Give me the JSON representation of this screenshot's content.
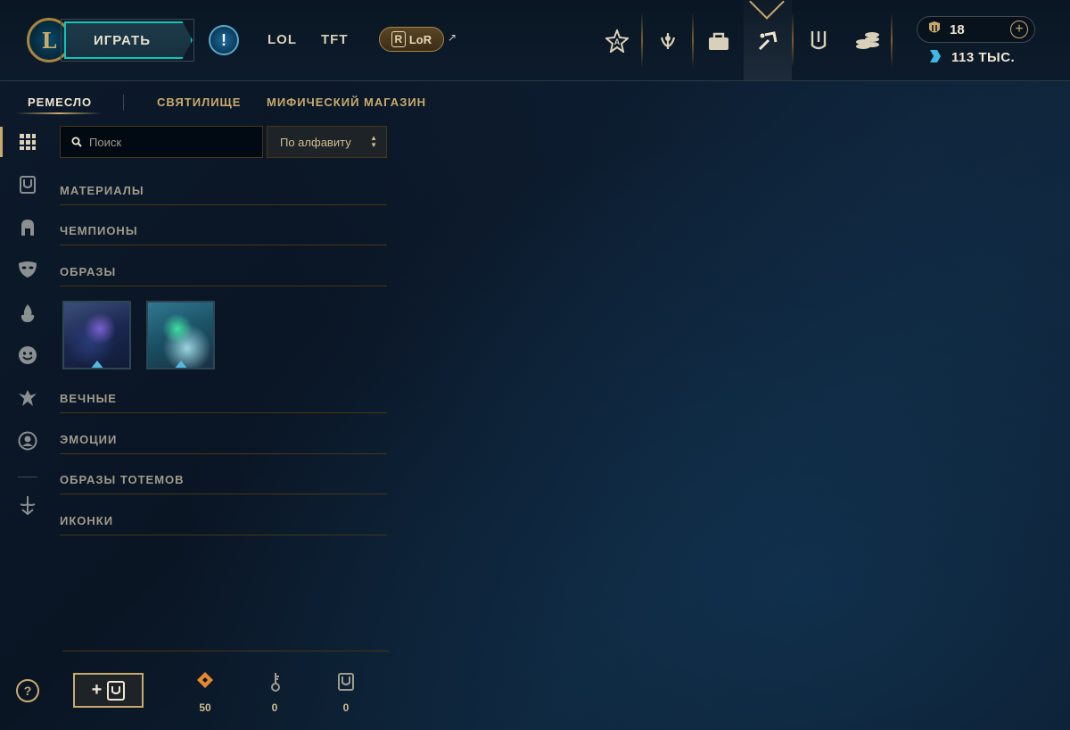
{
  "header": {
    "logo": "L",
    "play_label": "ИГРАТЬ",
    "alert_symbol": "!",
    "tabs": [
      "LOL",
      "TFT"
    ],
    "lor_label": "LoR",
    "lor_mark": "R",
    "lor_external": "↗",
    "nav_icons": [
      "home-crest-icon",
      "profile-laurel-icon",
      "collection-bag-icon",
      "loot-hammer-icon",
      "clash-banner-icon",
      "store-coins-icon"
    ],
    "active_nav": "loot-hammer-icon"
  },
  "currency": {
    "rp_value": "18",
    "be_value": "113 ТЫС.",
    "add_symbol": "+"
  },
  "subtabs": [
    "РЕМЕСЛО",
    "СВЯТИЛИЩЕ",
    "МИФИЧЕСКИЙ МАГАЗИН"
  ],
  "search": {
    "placeholder": "Поиск",
    "value": ""
  },
  "sort": {
    "selected": "По алфавиту"
  },
  "categories": [
    "МАТЕРИАЛЫ",
    "ЧЕМПИОНЫ",
    "ОБРАЗЫ",
    "ВЕЧНЫЕ",
    "ЭМОЦИИ",
    "ОБРАЗЫ ТОТЕМОВ",
    "ИКОНКИ"
  ],
  "skins": [
    {
      "name": "skin-shard-1"
    },
    {
      "name": "skin-shard-2"
    }
  ],
  "bottom": {
    "help_symbol": "?",
    "add_chest_symbol": "+",
    "resources": [
      {
        "icon": "orange-essence-icon",
        "count": "50",
        "color": "#e8892e"
      },
      {
        "icon": "key-icon",
        "count": "0",
        "color": "#a09b8c"
      },
      {
        "icon": "chest-icon",
        "count": "0",
        "color": "#a09b8c"
      }
    ]
  },
  "colors": {
    "gold": "#c8aa6e",
    "teal": "#0ac8b9",
    "blue_essence": "#3fb8e4"
  }
}
